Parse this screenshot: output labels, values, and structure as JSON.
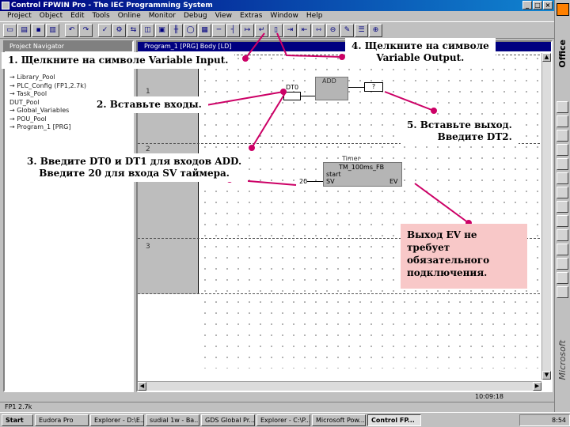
{
  "window": {
    "title": "Control FPWIN Pro - The IEC Programming System",
    "buttons": [
      "_",
      "□",
      "×"
    ]
  },
  "menu": [
    "Project",
    "Object",
    "Edit",
    "Tools",
    "Online",
    "Monitor",
    "Debug",
    "View",
    "Extras",
    "Window",
    "Help"
  ],
  "navigator": {
    "title": "Project Navigator",
    "tree": [
      "→ Library_Pool",
      "→ PLC_Config (FP1,2.7k)",
      "→ Task_Pool",
      "  DUT_Pool",
      "→ Global_Variables",
      "→ POU_Pool",
      "  → Program_1 [PRG]"
    ]
  },
  "pou": {
    "title": "Program_1 [PRG] Body [LD]",
    "rungs": [
      "1",
      "2",
      "3"
    ],
    "add": {
      "name": "ADD",
      "in1": "DT0",
      "out": "?"
    },
    "timer": {
      "title": "Timer",
      "type": "TM_100ms_FB",
      "start": "start",
      "sv": "SV",
      "ev": "EV",
      "sv_value": "20"
    }
  },
  "statusbar": {
    "left": "FP1 2.7k",
    "time": "10:09:18"
  },
  "office": {
    "label": "Office",
    "vendor": "Microsoft"
  },
  "taskbar": {
    "start": "Start",
    "items": [
      "Eudora Pro",
      "Explorer - D:\\E...",
      "sudial 1w - Ba...",
      "GDS Global Pr...",
      "Explorer - C:\\P...",
      "Microsoft Pow...",
      "Control FP..."
    ],
    "clock": "8:54"
  },
  "callouts": {
    "c1": "1. Щелкните на символе Variable Input.",
    "c2": "2. Вставьте входы.",
    "c3_line1": "3. Введите DT0 и DT1 для входов ADD.",
    "c3_line2": "Введите 20 для входа SV таймера.",
    "c4_line1": "4. Щелкните на символе",
    "c4_line2": "Variable Output.",
    "c5_line1": "5. Вставьте выход.",
    "c5_line2": "Введите DT2.",
    "c6_line1": "Выход EV не",
    "c6_line2": "требует",
    "c6_line3": "обязательного",
    "c6_line4": "подключения."
  },
  "colors": {
    "callout_line": "#cc0066",
    "note_bg": "#f8c8c8",
    "titlebar": "#000080"
  }
}
